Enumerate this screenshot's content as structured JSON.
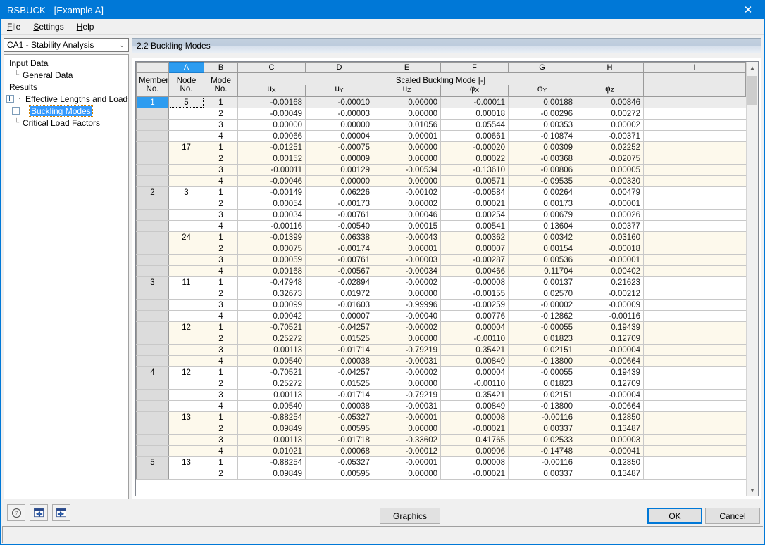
{
  "window": {
    "title": "RSBUCK - [Example A]",
    "close_label": "✕"
  },
  "menu": {
    "items": [
      {
        "label": "File",
        "accel": "F"
      },
      {
        "label": "Settings",
        "accel": "S"
      },
      {
        "label": "Help",
        "accel": "H"
      }
    ]
  },
  "sidebar": {
    "combo": {
      "value": "CA1 - Stability Analysis",
      "arrow": "⌄"
    },
    "tree": [
      {
        "label": "Input Data",
        "level": 0,
        "expander": false,
        "guide": "",
        "selected": false
      },
      {
        "label": "General Data",
        "level": 1,
        "expander": false,
        "guide": "└",
        "selected": false
      },
      {
        "label": "Results",
        "level": 0,
        "expander": false,
        "guide": "",
        "selected": false
      },
      {
        "label": "Effective Lengths and Loads",
        "level": 1,
        "expander": true,
        "guide": "",
        "selected": false
      },
      {
        "label": "Buckling Modes",
        "level": 1,
        "expander": true,
        "guide": "",
        "selected": true
      },
      {
        "label": "Critical Load Factors",
        "level": 1,
        "expander": false,
        "guide": "└",
        "selected": false
      }
    ]
  },
  "panel": {
    "header": "2.2 Buckling Modes"
  },
  "table": {
    "column_letters": [
      "",
      "A",
      "B",
      "C",
      "D",
      "E",
      "F",
      "G",
      "H",
      "I"
    ],
    "selected_column_letter": "A",
    "group_header": "Scaled Buckling Mode [-]",
    "header_line1": [
      "Member",
      "Node",
      "Mode",
      "",
      "",
      "",
      "",
      "",
      "",
      ""
    ],
    "header_line2": [
      "No.",
      "No.",
      "No.",
      "",
      "",
      "",
      "",
      "",
      "",
      ""
    ],
    "unit_symbols": [
      {
        "base": "u",
        "sub": "X"
      },
      {
        "base": "u",
        "sub": "Y"
      },
      {
        "base": "u",
        "sub": "Z"
      },
      {
        "base": "φ",
        "sub": "X"
      },
      {
        "base": "φ",
        "sub": "Y"
      },
      {
        "base": "φ",
        "sub": "Z"
      }
    ],
    "rows": [
      {
        "member": "1",
        "node": "5",
        "mode": "1",
        "values": [
          "-0.00168",
          "-0.00010",
          "0.00000",
          "-0.00011",
          "0.00188",
          "0.00846"
        ],
        "alt": false,
        "current": true,
        "member_selected": true,
        "node_focus": true
      },
      {
        "member": "",
        "node": "",
        "mode": "2",
        "values": [
          "-0.00049",
          "-0.00003",
          "0.00000",
          "0.00018",
          "-0.00296",
          "0.00272"
        ],
        "alt": false,
        "current": false,
        "member_selected": false,
        "node_focus": false
      },
      {
        "member": "",
        "node": "",
        "mode": "3",
        "values": [
          "0.00000",
          "0.00000",
          "0.01056",
          "0.05544",
          "0.00353",
          "0.00002"
        ],
        "alt": false,
        "current": false,
        "member_selected": false,
        "node_focus": false
      },
      {
        "member": "",
        "node": "",
        "mode": "4",
        "values": [
          "0.00066",
          "0.00004",
          "0.00001",
          "0.00661",
          "-0.10874",
          "-0.00371"
        ],
        "alt": false,
        "current": false,
        "member_selected": false,
        "node_focus": false
      },
      {
        "member": "",
        "node": "17",
        "mode": "1",
        "values": [
          "-0.01251",
          "-0.00075",
          "0.00000",
          "-0.00020",
          "0.00309",
          "0.02252"
        ],
        "alt": true,
        "current": false,
        "member_selected": false,
        "node_focus": false
      },
      {
        "member": "",
        "node": "",
        "mode": "2",
        "values": [
          "0.00152",
          "0.00009",
          "0.00000",
          "0.00022",
          "-0.00368",
          "-0.02075"
        ],
        "alt": true,
        "current": false,
        "member_selected": false,
        "node_focus": false
      },
      {
        "member": "",
        "node": "",
        "mode": "3",
        "values": [
          "-0.00011",
          "0.00129",
          "-0.00534",
          "-0.13610",
          "-0.00806",
          "0.00005"
        ],
        "alt": true,
        "current": false,
        "member_selected": false,
        "node_focus": false
      },
      {
        "member": "",
        "node": "",
        "mode": "4",
        "values": [
          "-0.00046",
          "0.00000",
          "0.00000",
          "0.00571",
          "-0.09535",
          "-0.00330"
        ],
        "alt": true,
        "current": false,
        "member_selected": false,
        "node_focus": false
      },
      {
        "member": "2",
        "node": "3",
        "mode": "1",
        "values": [
          "-0.00149",
          "0.06226",
          "-0.00102",
          "-0.00584",
          "0.00264",
          "0.00479"
        ],
        "alt": false,
        "current": false,
        "member_selected": false,
        "node_focus": false
      },
      {
        "member": "",
        "node": "",
        "mode": "2",
        "values": [
          "0.00054",
          "-0.00173",
          "0.00002",
          "0.00021",
          "0.00173",
          "-0.00001"
        ],
        "alt": false,
        "current": false,
        "member_selected": false,
        "node_focus": false
      },
      {
        "member": "",
        "node": "",
        "mode": "3",
        "values": [
          "0.00034",
          "-0.00761",
          "0.00046",
          "0.00254",
          "0.00679",
          "0.00026"
        ],
        "alt": false,
        "current": false,
        "member_selected": false,
        "node_focus": false
      },
      {
        "member": "",
        "node": "",
        "mode": "4",
        "values": [
          "-0.00116",
          "-0.00540",
          "0.00015",
          "0.00541",
          "0.13604",
          "0.00377"
        ],
        "alt": false,
        "current": false,
        "member_selected": false,
        "node_focus": false
      },
      {
        "member": "",
        "node": "24",
        "mode": "1",
        "values": [
          "-0.01399",
          "0.06338",
          "-0.00043",
          "0.00362",
          "0.00342",
          "0.03160"
        ],
        "alt": true,
        "current": false,
        "member_selected": false,
        "node_focus": false
      },
      {
        "member": "",
        "node": "",
        "mode": "2",
        "values": [
          "0.00075",
          "-0.00174",
          "0.00001",
          "0.00007",
          "0.00154",
          "-0.00018"
        ],
        "alt": true,
        "current": false,
        "member_selected": false,
        "node_focus": false
      },
      {
        "member": "",
        "node": "",
        "mode": "3",
        "values": [
          "0.00059",
          "-0.00761",
          "-0.00003",
          "-0.00287",
          "0.00536",
          "-0.00001"
        ],
        "alt": true,
        "current": false,
        "member_selected": false,
        "node_focus": false
      },
      {
        "member": "",
        "node": "",
        "mode": "4",
        "values": [
          "0.00168",
          "-0.00567",
          "-0.00034",
          "0.00466",
          "0.11704",
          "0.00402"
        ],
        "alt": true,
        "current": false,
        "member_selected": false,
        "node_focus": false
      },
      {
        "member": "3",
        "node": "11",
        "mode": "1",
        "values": [
          "-0.47948",
          "-0.02894",
          "-0.00002",
          "-0.00008",
          "0.00137",
          "0.21623"
        ],
        "alt": false,
        "current": false,
        "member_selected": false,
        "node_focus": false
      },
      {
        "member": "",
        "node": "",
        "mode": "2",
        "values": [
          "0.32673",
          "0.01972",
          "0.00000",
          "-0.00155",
          "0.02570",
          "-0.00212"
        ],
        "alt": false,
        "current": false,
        "member_selected": false,
        "node_focus": false
      },
      {
        "member": "",
        "node": "",
        "mode": "3",
        "values": [
          "0.00099",
          "-0.01603",
          "-0.99996",
          "-0.00259",
          "-0.00002",
          "-0.00009"
        ],
        "alt": false,
        "current": false,
        "member_selected": false,
        "node_focus": false
      },
      {
        "member": "",
        "node": "",
        "mode": "4",
        "values": [
          "0.00042",
          "0.00007",
          "-0.00040",
          "0.00776",
          "-0.12862",
          "-0.00116"
        ],
        "alt": false,
        "current": false,
        "member_selected": false,
        "node_focus": false
      },
      {
        "member": "",
        "node": "12",
        "mode": "1",
        "values": [
          "-0.70521",
          "-0.04257",
          "-0.00002",
          "0.00004",
          "-0.00055",
          "0.19439"
        ],
        "alt": true,
        "current": false,
        "member_selected": false,
        "node_focus": false
      },
      {
        "member": "",
        "node": "",
        "mode": "2",
        "values": [
          "0.25272",
          "0.01525",
          "0.00000",
          "-0.00110",
          "0.01823",
          "0.12709"
        ],
        "alt": true,
        "current": false,
        "member_selected": false,
        "node_focus": false
      },
      {
        "member": "",
        "node": "",
        "mode": "3",
        "values": [
          "0.00113",
          "-0.01714",
          "-0.79219",
          "0.35421",
          "0.02151",
          "-0.00004"
        ],
        "alt": true,
        "current": false,
        "member_selected": false,
        "node_focus": false
      },
      {
        "member": "",
        "node": "",
        "mode": "4",
        "values": [
          "0.00540",
          "0.00038",
          "-0.00031",
          "0.00849",
          "-0.13800",
          "-0.00664"
        ],
        "alt": true,
        "current": false,
        "member_selected": false,
        "node_focus": false
      },
      {
        "member": "4",
        "node": "12",
        "mode": "1",
        "values": [
          "-0.70521",
          "-0.04257",
          "-0.00002",
          "0.00004",
          "-0.00055",
          "0.19439"
        ],
        "alt": false,
        "current": false,
        "member_selected": false,
        "node_focus": false
      },
      {
        "member": "",
        "node": "",
        "mode": "2",
        "values": [
          "0.25272",
          "0.01525",
          "0.00000",
          "-0.00110",
          "0.01823",
          "0.12709"
        ],
        "alt": false,
        "current": false,
        "member_selected": false,
        "node_focus": false
      },
      {
        "member": "",
        "node": "",
        "mode": "3",
        "values": [
          "0.00113",
          "-0.01714",
          "-0.79219",
          "0.35421",
          "0.02151",
          "-0.00004"
        ],
        "alt": false,
        "current": false,
        "member_selected": false,
        "node_focus": false
      },
      {
        "member": "",
        "node": "",
        "mode": "4",
        "values": [
          "0.00540",
          "0.00038",
          "-0.00031",
          "0.00849",
          "-0.13800",
          "-0.00664"
        ],
        "alt": false,
        "current": false,
        "member_selected": false,
        "node_focus": false
      },
      {
        "member": "",
        "node": "13",
        "mode": "1",
        "values": [
          "-0.88254",
          "-0.05327",
          "-0.00001",
          "0.00008",
          "-0.00116",
          "0.12850"
        ],
        "alt": true,
        "current": false,
        "member_selected": false,
        "node_focus": false
      },
      {
        "member": "",
        "node": "",
        "mode": "2",
        "values": [
          "0.09849",
          "0.00595",
          "0.00000",
          "-0.00021",
          "0.00337",
          "0.13487"
        ],
        "alt": true,
        "current": false,
        "member_selected": false,
        "node_focus": false
      },
      {
        "member": "",
        "node": "",
        "mode": "3",
        "values": [
          "0.00113",
          "-0.01718",
          "-0.33602",
          "0.41765",
          "0.02533",
          "0.00003"
        ],
        "alt": true,
        "current": false,
        "member_selected": false,
        "node_focus": false
      },
      {
        "member": "",
        "node": "",
        "mode": "4",
        "values": [
          "0.01021",
          "0.00068",
          "-0.00012",
          "0.00906",
          "-0.14748",
          "-0.00041"
        ],
        "alt": true,
        "current": false,
        "member_selected": false,
        "node_focus": false
      },
      {
        "member": "5",
        "node": "13",
        "mode": "1",
        "values": [
          "-0.88254",
          "-0.05327",
          "-0.00001",
          "0.00008",
          "-0.00116",
          "0.12850"
        ],
        "alt": false,
        "current": false,
        "member_selected": false,
        "node_focus": false
      },
      {
        "member": "",
        "node": "",
        "mode": "2",
        "values": [
          "0.09849",
          "0.00595",
          "0.00000",
          "-0.00021",
          "0.00337",
          "0.13487"
        ],
        "alt": false,
        "current": false,
        "member_selected": false,
        "node_focus": false
      }
    ]
  },
  "scrollbar": {
    "up_arrow": "▲",
    "down_arrow": "▼"
  },
  "toolbar": {
    "help_icon": "?",
    "prev_label": "prev-view-icon",
    "next_label": "next-view-icon"
  },
  "buttons": {
    "graphics": "Graphics",
    "graphics_accel": "G",
    "ok": "OK",
    "cancel": "Cancel"
  },
  "status": {
    "text": ""
  },
  "colors": {
    "title_blue": "#0078d7",
    "selection_blue": "#2d9cf0",
    "alt_row": "#fdf9ec",
    "header_gray": "#e9e9e9"
  }
}
